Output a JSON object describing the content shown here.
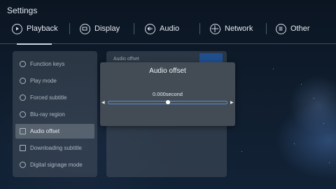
{
  "app": {
    "title": "Settings"
  },
  "tabs": [
    {
      "label": "Playback",
      "icon": "play-icon",
      "selected": true
    },
    {
      "label": "Display",
      "icon": "display-icon"
    },
    {
      "label": "Audio",
      "icon": "audio-icon"
    },
    {
      "label": "Network",
      "icon": "network-icon"
    },
    {
      "label": "Other",
      "icon": "other-icon"
    }
  ],
  "menu": [
    {
      "label": "Function keys",
      "icon": "function-keys-icon"
    },
    {
      "label": "Play mode",
      "icon": "play-mode-icon"
    },
    {
      "label": "Forced subtitle",
      "icon": "subtitle-icon"
    },
    {
      "label": "Blu-ray region",
      "icon": "bluray-icon"
    },
    {
      "label": "Audio offset",
      "icon": "audio-offset-icon",
      "active": true
    },
    {
      "label": "Downloading subtitle",
      "icon": "download-subtitle-icon"
    },
    {
      "label": "Digital signage mode",
      "icon": "signage-icon"
    }
  ],
  "right_panel": {
    "label": "Audio offset"
  },
  "dialog": {
    "title": "Audio offset",
    "value": "0.000second",
    "level": 0.5,
    "left_arrow": "◀",
    "right_arrow": "▶"
  },
  "colors": {
    "accent": "#5a8fd6",
    "button": "#1f4f8e",
    "dialog_bg": "#434c55"
  }
}
